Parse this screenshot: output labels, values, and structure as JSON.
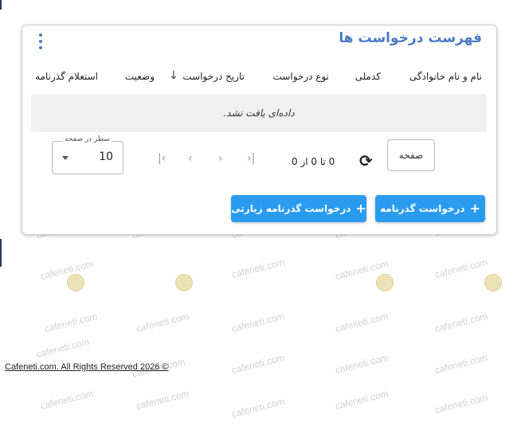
{
  "card": {
    "title": "فهرست درخواست ها",
    "columns": [
      {
        "label": "نام و نام خانوادگی"
      },
      {
        "label": "کدملی"
      },
      {
        "label": "نوع درخواست"
      },
      {
        "label": "تاریخ درخواست"
      },
      {
        "label": "وضعیت"
      },
      {
        "label": "استعلام گذرنامه"
      }
    ],
    "sort_icon": "arrow-down-icon",
    "empty_message": "داده‌ای یافت نشد.",
    "rows_per_page": {
      "label": "سطر در صفحه",
      "value": "10"
    },
    "pagination": {
      "range": "0 تا 0 از 0",
      "page_label": "صفحه"
    },
    "buttons": {
      "passport_request": "درخواست گذرنامه",
      "pilgrimage_passport_request": "درخواست گذرنامه زیارتی"
    }
  },
  "watermark": "cafeneti.com",
  "footer": "Cafeneti.com. All Rights Reserved 2026 ©",
  "colors": {
    "accent": "#4a7ac4",
    "button": "#2a9cf0",
    "empty_row_bg": "#f0f0f0"
  }
}
